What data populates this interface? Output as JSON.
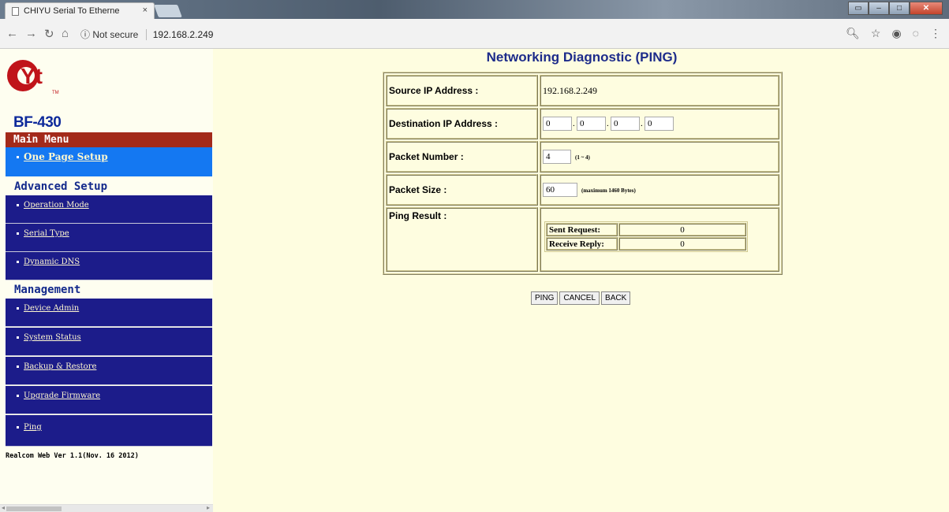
{
  "browser": {
    "tab_title": "CHIYU Serial To Etherne",
    "tab_close": "×",
    "security": "ⓘ Not secure",
    "url": "192.168.2.249"
  },
  "sidebar": {
    "logo_text": "Yt",
    "logo_tm": "TM",
    "model": "BF-430",
    "main_menu": "Main Menu",
    "one_page_setup": "One Page Setup",
    "advanced_title": "Advanced Setup",
    "advanced_items": [
      "Operation Mode",
      "Serial Type",
      "Dynamic DNS"
    ],
    "management_title": "Management",
    "management_items": [
      "Device Admin",
      "System Status",
      "Backup & Restore",
      "Upgrade Firmware",
      "Ping"
    ],
    "version": "Realcom Web Ver 1.1(Nov. 16 2012)"
  },
  "main": {
    "title": "Networking Diagnostic (PING)",
    "source_label": "Source IP Address :",
    "source_value": "192.168.2.249",
    "dest_label": "Destination IP Address :",
    "dest_octets": [
      "0",
      "0",
      "0",
      "0"
    ],
    "packet_number_label": "Packet Number :",
    "packet_number_value": "4",
    "packet_number_hint": "(1 ~ 4)",
    "packet_size_label": "Packet Size :",
    "packet_size_value": "60",
    "packet_size_hint": "(maximum 1460 Bytes)",
    "result_label": "Ping Result :",
    "sent_label": "Sent Request:",
    "sent_value": "0",
    "reply_label": "Receive Reply:",
    "reply_value": "0",
    "buttons": {
      "ping": "PING",
      "cancel": "CANCEL",
      "back": "BACK"
    }
  },
  "colors": {
    "page_bg": "#fefde0",
    "menu_dark_blue": "#1c1c8a",
    "menu_active_blue": "#1478f2",
    "main_menu_red": "#a32a1a",
    "title_blue": "#1d2b8a"
  }
}
